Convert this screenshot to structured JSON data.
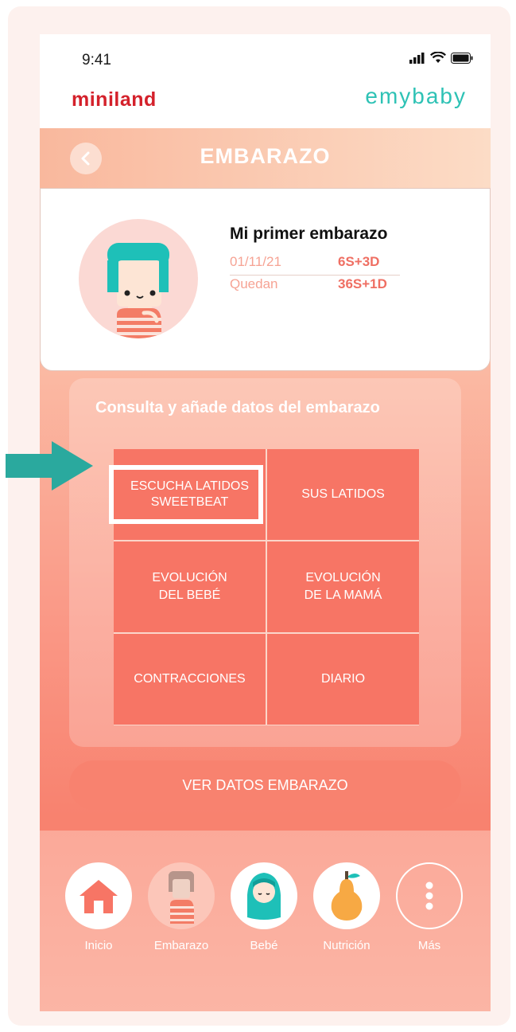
{
  "status": {
    "time": "9:41"
  },
  "brand": {
    "left": "miniland",
    "right": "emybaby"
  },
  "header": {
    "title": "EMBARAZO",
    "back_icon": "chevron-left-icon"
  },
  "profile": {
    "name": "Mi primer embarazo",
    "row1_label": "01/11/21",
    "row1_value": "6S+3D",
    "row2_label": "Quedan",
    "row2_value": "36S+1D"
  },
  "panel": {
    "title": "Consulta y añade datos del embarazo",
    "cells": [
      {
        "label": "ESCUCHA LATIDOS SWEETBEAT"
      },
      {
        "label": "SUS LATIDOS"
      },
      {
        "label": "EVOLUCIÓN DEL BEBÉ"
      },
      {
        "label": "EVOLUCIÓN DE LA MAMÁ"
      },
      {
        "label": "CONTRACCIONES"
      },
      {
        "label": "DIARIO"
      }
    ]
  },
  "button": {
    "label": "VER DATOS EMBARAZO"
  },
  "nav": [
    {
      "label": "Inicio",
      "icon": "home-icon"
    },
    {
      "label": "Embarazo",
      "icon": "pregnancy-icon"
    },
    {
      "label": "Bebé",
      "icon": "baby-icon"
    },
    {
      "label": "Nutrición",
      "icon": "pear-icon"
    },
    {
      "label": "Más",
      "icon": "more-icon"
    }
  ],
  "colors": {
    "accent": "#f77565",
    "brand_red": "#d4212b",
    "brand_teal": "#2ec2b5"
  }
}
